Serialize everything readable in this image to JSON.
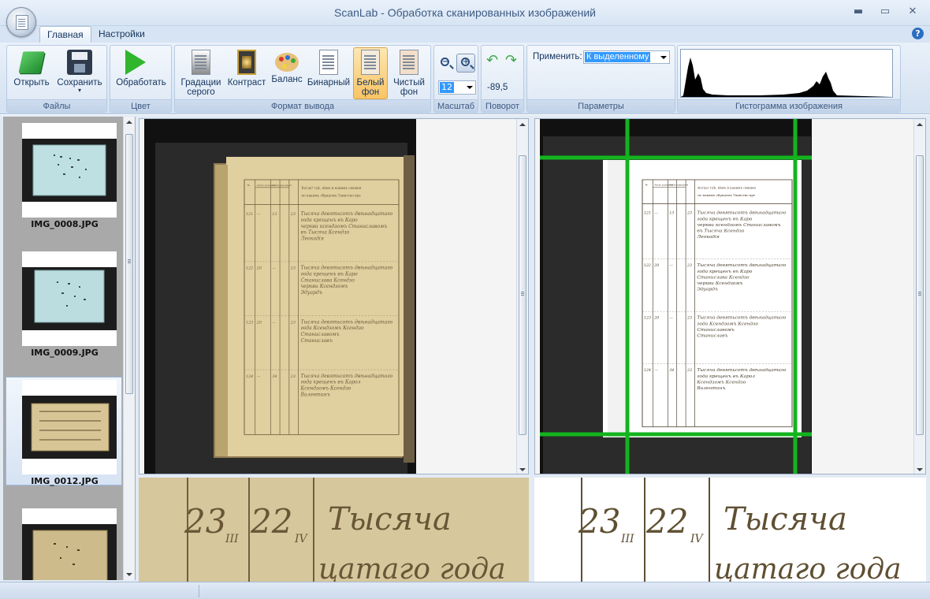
{
  "window": {
    "title": "ScanLab - Обработка сканированных изображений",
    "minimize": "▬",
    "maximize": "▭",
    "close": "✕"
  },
  "tabs": [
    {
      "label": "Главная",
      "active": true
    },
    {
      "label": "Настройки",
      "active": false
    }
  ],
  "help": "?",
  "ribbon": {
    "groups": {
      "files": "Файлы",
      "color": "Цвет",
      "output_format": "Формат вывода",
      "scale": "Масштаб",
      "rotation": "Поворот",
      "parameters": "Параметры",
      "histogram": "Гистограмма изображения"
    },
    "buttons": {
      "open": "Открыть",
      "save": "Сохранить",
      "process": "Обработать",
      "grayscale_1": "Градации",
      "grayscale_2": "серого",
      "contrast": "Контраст",
      "balance": "Баланс",
      "binary": "Бинарный",
      "white_bg_1": "Белый",
      "white_bg_2": "фон",
      "clean_bg_1": "Чистый",
      "clean_bg_2": "фон"
    },
    "active_format": "white_bg",
    "zoom": {
      "value": "12"
    },
    "rotation": {
      "value": "-89,5"
    },
    "apply": {
      "label": "Применить:",
      "value": "К выделенному"
    }
  },
  "thumbnails": [
    {
      "name": "IMG_0008.JPG",
      "selected": false,
      "tone": "#bfe0e3"
    },
    {
      "name": "IMG_0009.JPG",
      "selected": false,
      "tone": "#bcdde0"
    },
    {
      "name": "IMG_0012.JPG",
      "selected": true,
      "tone": "#d8c596"
    },
    {
      "name": "",
      "selected": false,
      "tone": "#cdbb8c"
    }
  ],
  "document": {
    "header_1": "Когда? гдѣ, кѣмъ и какимъ священ",
    "header_2": "по какимъ обрядомъ Таинство кре",
    "col_headers": [
      "№",
      "Число рожденія",
      "Число крещенія"
    ],
    "rows": [
      {
        "num": "121",
        "a": "—",
        "b": "13",
        "c": "23",
        "text": [
          "Тысяча девятьсотъ двѣнадцатаго",
          "года крещенъ въ Каро",
          "черкви ксендзомъ Станиславомъ",
          "въ Тысяча Ксендзо",
          "Леокадія"
        ]
      },
      {
        "num": "122",
        "a": "20",
        "b": "—",
        "c": "23",
        "text": [
          "Тысяча девятьсотъ двѣнадцатаго",
          "года крещенъ въ Каро",
          "Станислава Ксендзо",
          "черкви Ксендзомъ",
          "Эдуардъ"
        ]
      },
      {
        "num": "123",
        "a": "20",
        "b": "—",
        "c": "23",
        "text": [
          "Тысяча девятьсотъ двѣнадцатаго",
          "года Ксендзомъ Ксендзо",
          "Станиславомъ",
          "Станиславъ"
        ]
      },
      {
        "num": "124",
        "a": "—",
        "b": "34",
        "c": "23",
        "text": [
          "Тысяча девятьсотъ двѣнадцатаго",
          "года крещенъ въ Карол",
          "Ксендзомъ Ксендзо",
          "Валентинъ"
        ]
      }
    ]
  },
  "detail": {
    "d1": "23",
    "d1sub": "III",
    "d2": "22",
    "d2sub": "IV",
    "word1": "Тысяча",
    "word2": "цатаго года"
  },
  "colors": {
    "crop_lines": "#13b41e",
    "selection": "#3399ff",
    "highlight": "#f9c464"
  }
}
